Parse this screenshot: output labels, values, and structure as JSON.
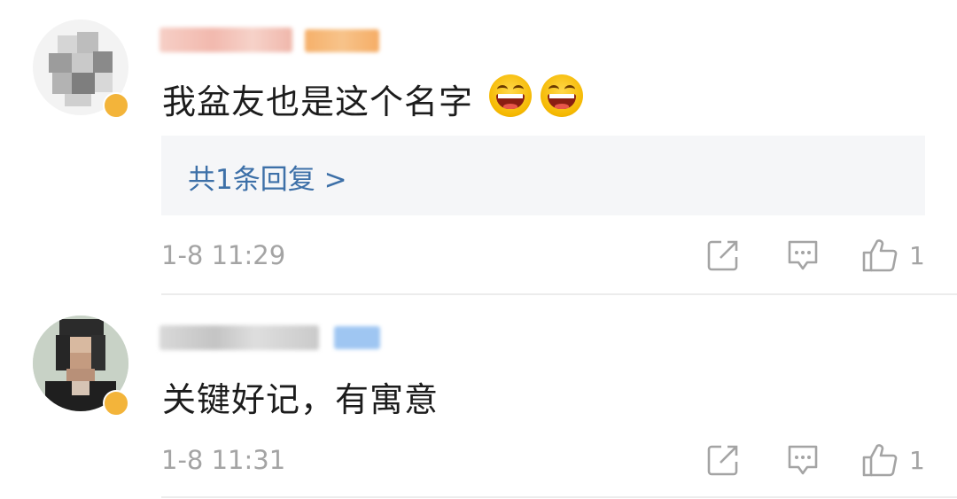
{
  "comments": [
    {
      "text": "我盆友也是这个名字",
      "emojis": [
        "laughing-emoji",
        "laughing-emoji"
      ],
      "replies_label": "共1条回复 >",
      "time": "1-8 11:29",
      "likes": "1"
    },
    {
      "text": "关键好记，有寓意",
      "time": "1-8 11:31",
      "likes": "1"
    }
  ],
  "colors": {
    "link": "#3d70a8",
    "meta": "#a4a4a4",
    "text": "#1c1c1c",
    "reply_bg": "#f5f6f8",
    "verified_badge": "#f3b43a"
  },
  "icons": {
    "repost": "repost-icon",
    "comment": "comment-icon",
    "like": "thumbs-up-icon"
  }
}
